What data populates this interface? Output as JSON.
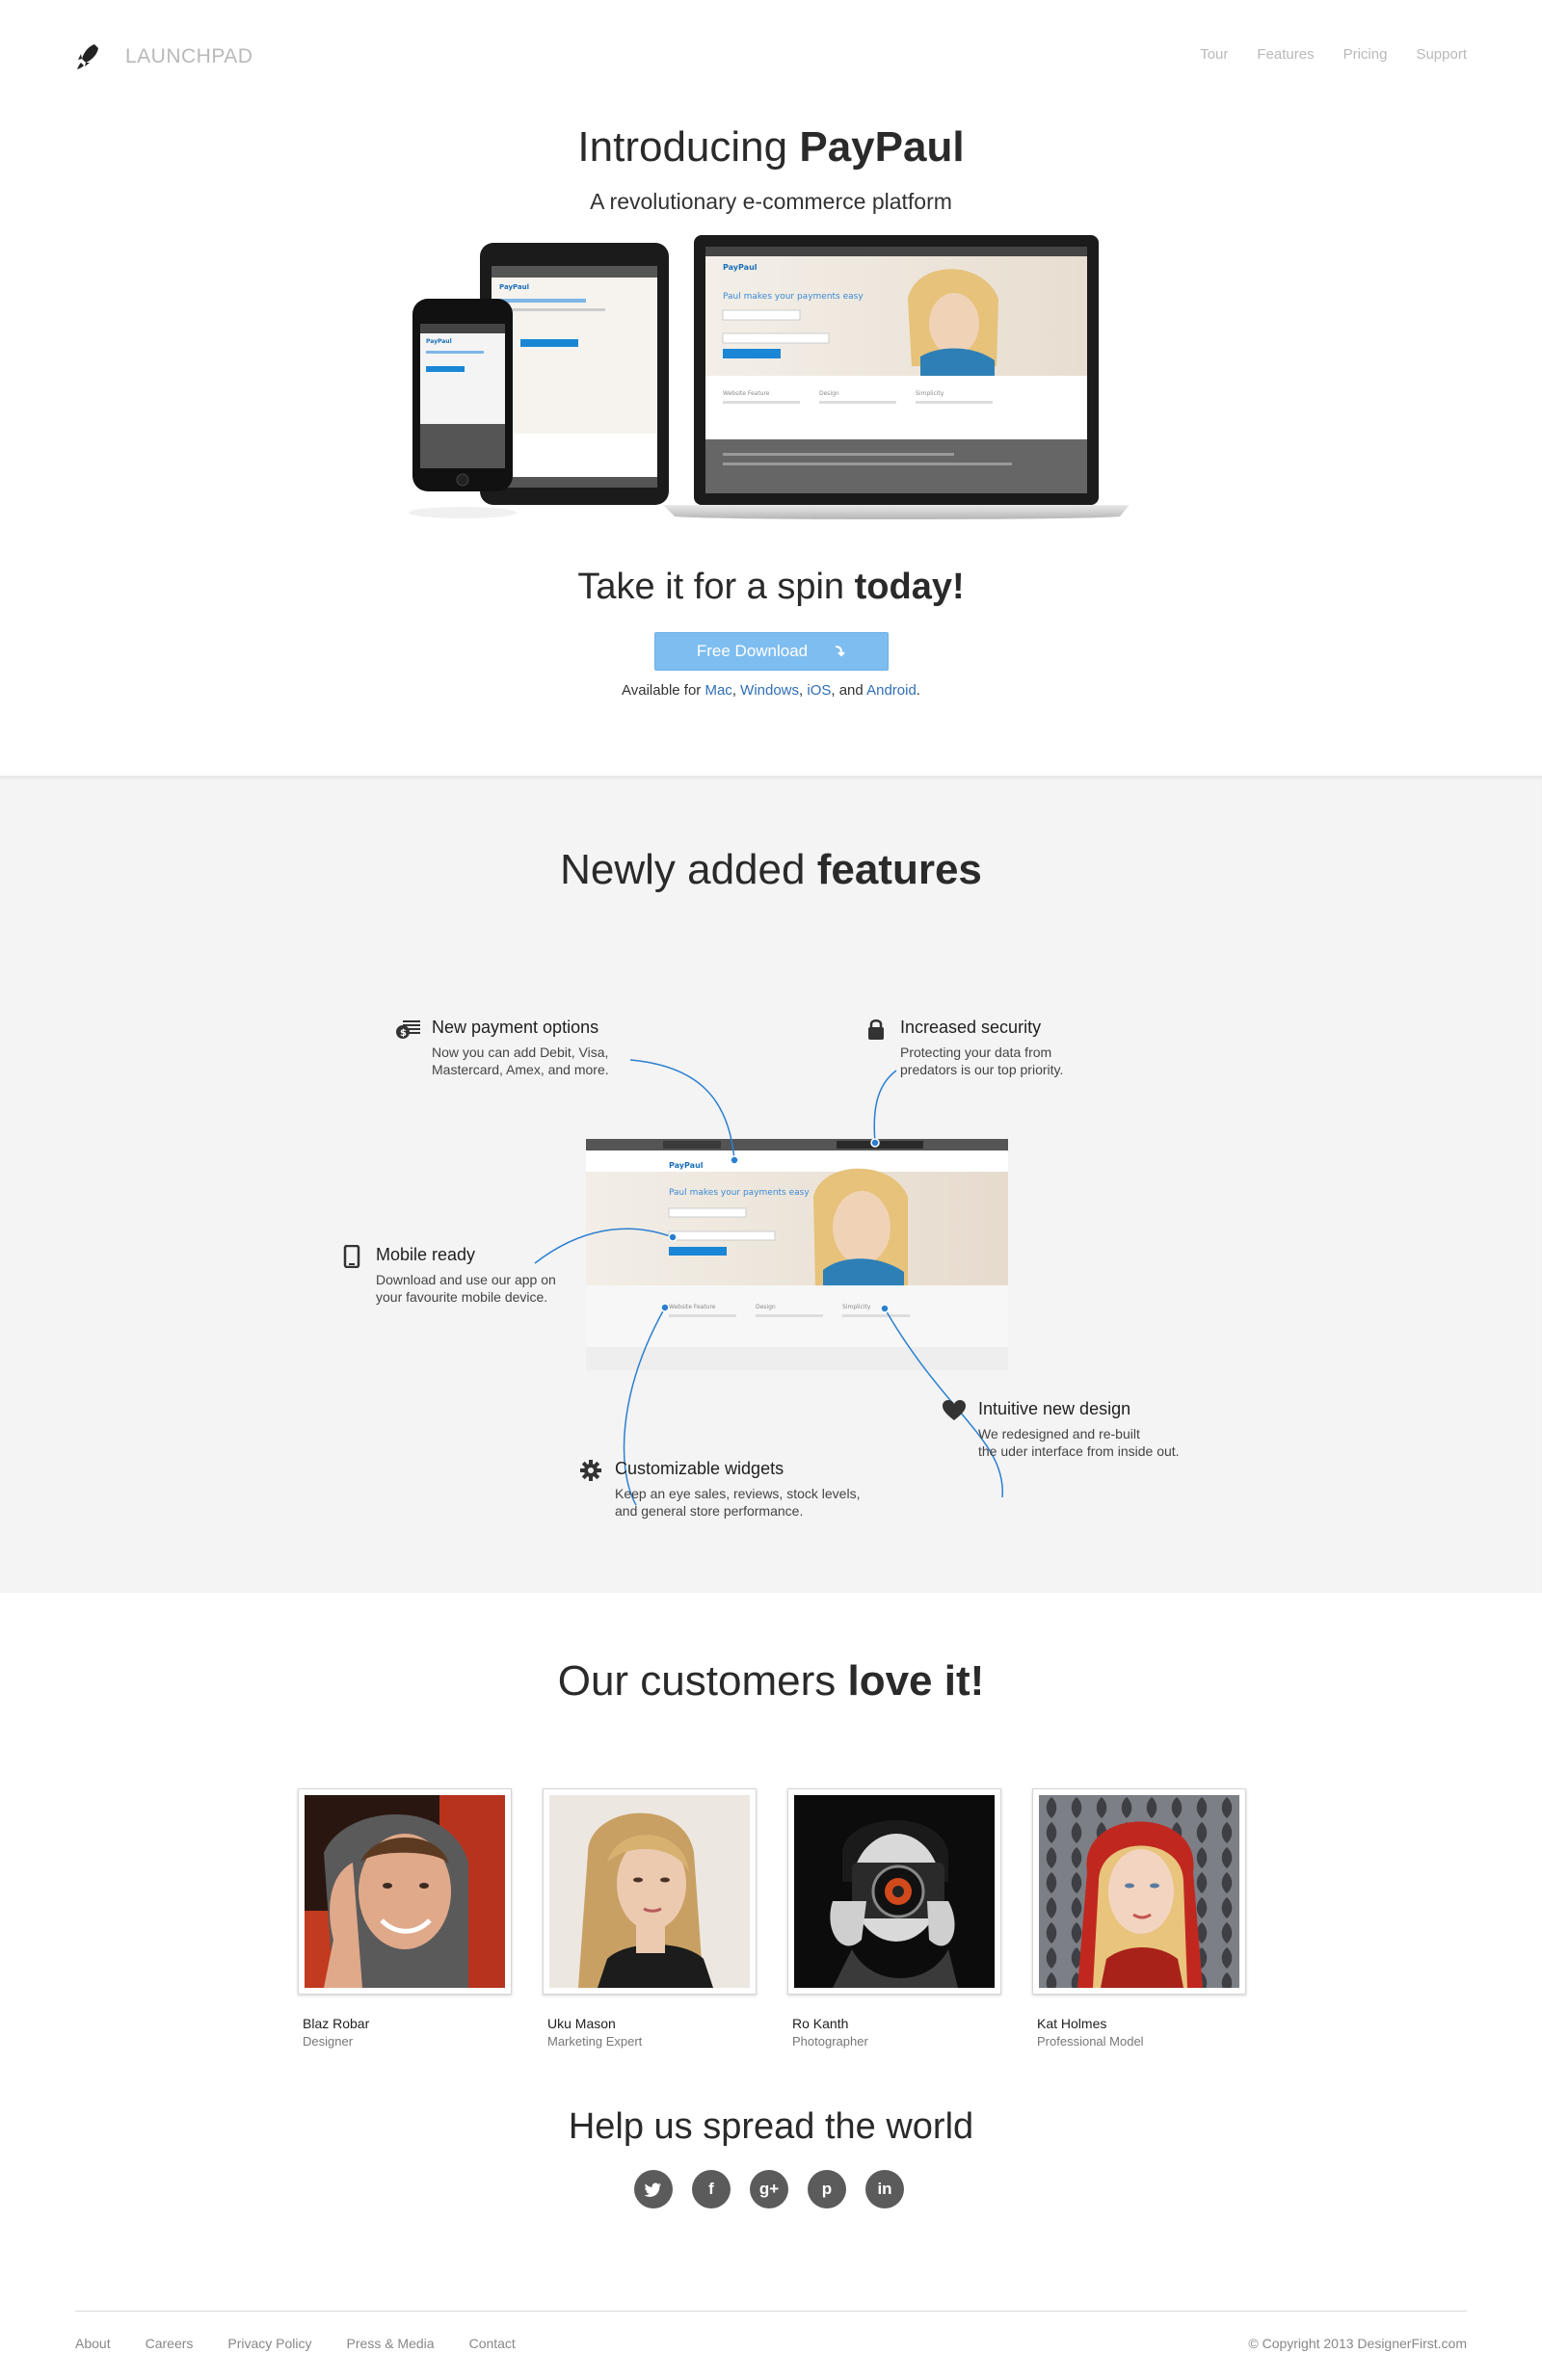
{
  "header": {
    "logo_text": "LAUNCHPAD",
    "nav": [
      {
        "label": "Tour"
      },
      {
        "label": "Features"
      },
      {
        "label": "Pricing"
      },
      {
        "label": "Support"
      }
    ]
  },
  "hero": {
    "title_prefix": "Introducing",
    "title_bold": "PayPaul",
    "subtitle": "A revolutionary e-commerce platform",
    "spin_prefix": "Take it for a spin",
    "spin_bold": "today!",
    "download_label": "Free Download",
    "available_prefix": "Available for",
    "platforms": [
      "Mac",
      "Windows",
      "iOS",
      "Android"
    ],
    "available_sep1": ",",
    "available_sep2": ", and",
    "available_end": ".",
    "screen": {
      "brand": "PayPaul",
      "headline": "Paul makes your payments easy",
      "col1": "Website Feature",
      "col2": "Design",
      "col3": "Simplicity"
    }
  },
  "features": {
    "title_prefix": "Newly added",
    "title_bold": "features",
    "items": [
      {
        "title": "New payment options",
        "desc1": "Now you can add Debit, Visa,",
        "desc2": "Mastercard, Amex, and more.",
        "icon": "cash-icon"
      },
      {
        "title": "Increased security",
        "desc1": "Protecting your data from",
        "desc2": "predators is our top priority.",
        "icon": "lock-icon"
      },
      {
        "title": "Mobile ready",
        "desc1": "Download and use our app on",
        "desc2": "your favourite mobile device.",
        "icon": "phone-icon"
      },
      {
        "title": "Intuitive new design",
        "desc1": "We redesigned and re-built",
        "desc2": "the uder interface from inside out.",
        "icon": "heart-icon"
      },
      {
        "title": "Customizable widgets",
        "desc1": "Keep an eye sales, reviews, stock levels,",
        "desc2": "and general store performance.",
        "icon": "gear-icon"
      }
    ]
  },
  "customers": {
    "title_prefix": "Our customers",
    "title_bold": "love it!",
    "people": [
      {
        "name": "Blaz Robar",
        "role": "Designer"
      },
      {
        "name": "Uku Mason",
        "role": "Marketing Expert"
      },
      {
        "name": "Ro Kanth",
        "role": "Photographer"
      },
      {
        "name": "Kat Holmes",
        "role": "Professional Model"
      }
    ]
  },
  "spread": {
    "title": "Help us spread the world",
    "socials": [
      {
        "icon": "twitter-icon"
      },
      {
        "icon": "facebook-icon",
        "glyph": "f"
      },
      {
        "icon": "google-plus-icon",
        "glyph": "g+"
      },
      {
        "icon": "pinterest-icon",
        "glyph": "p"
      },
      {
        "icon": "linkedin-icon",
        "glyph": "in"
      }
    ]
  },
  "footer": {
    "links": [
      "About",
      "Careers",
      "Privacy Policy",
      "Press & Media",
      "Contact"
    ],
    "copyright": "© Copyright 2013 DesignerFirst.com"
  },
  "colors": {
    "accent": "#7ebdef",
    "link": "#2f6eb6",
    "section_bg": "#f4f4f4",
    "social_bg": "#5b5b5b"
  }
}
